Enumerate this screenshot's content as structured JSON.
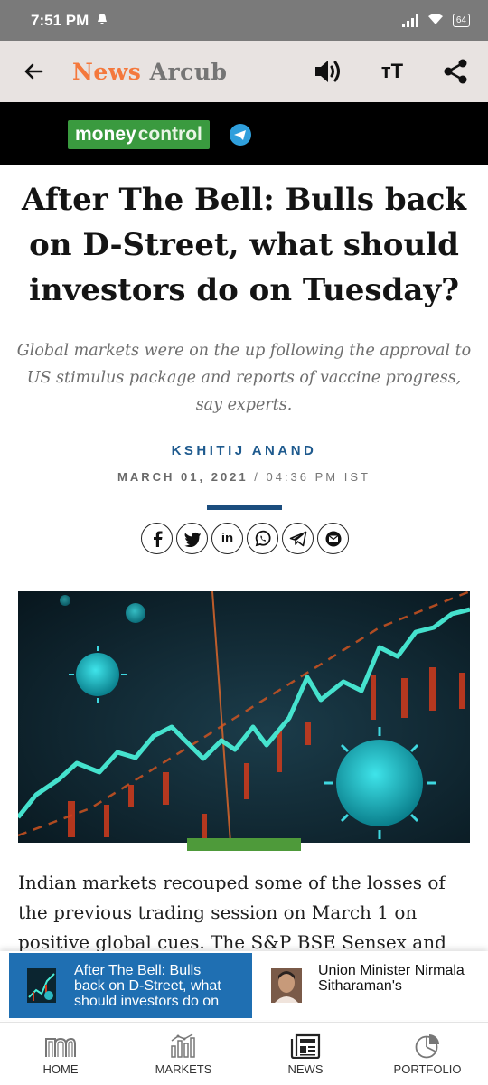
{
  "status_bar": {
    "time": "7:51 PM",
    "battery": "64"
  },
  "app_bar": {
    "brand_part1": "News",
    "brand_part2": "Arcub",
    "text_size_label": "тT"
  },
  "source": {
    "logo_part1": "money",
    "logo_part2": "control"
  },
  "article": {
    "headline": "After The Bell: Bulls back on D-Street, what should investors do on Tuesday?",
    "summary": "Global markets were on the up following the approval to US stimulus package and reports of vaccine progress, say experts.",
    "author": "KSHITIJ ANAND",
    "date": "MARCH 01, 2021",
    "date_separator": " / ",
    "time": "04:36 PM IST",
    "body": "Indian markets recouped some of the losses of the previous trading session on March 1 on positive global cues. The S&P BSE Sensex and"
  },
  "share_buttons": [
    "facebook",
    "twitter",
    "linkedin",
    "whatsapp",
    "telegram",
    "email"
  ],
  "related": [
    {
      "title": "After The Bell: Bulls back on D-Street, what should investors do on Tuesday?"
    },
    {
      "title": "Union Minister Nirmala Sitharaman's"
    }
  ],
  "nav": [
    {
      "label": "HOME",
      "icon": "home-icon"
    },
    {
      "label": "MARKETS",
      "icon": "markets-icon"
    },
    {
      "label": "NEWS",
      "icon": "news-icon"
    },
    {
      "label": "PORTFOLIO",
      "icon": "portfolio-icon"
    }
  ],
  "colors": {
    "brand_orange": "#f4783c",
    "author_blue": "#1e5a8e",
    "related_blue": "#1f6fb2",
    "moneycontrol_green": "#3a9a3f"
  }
}
